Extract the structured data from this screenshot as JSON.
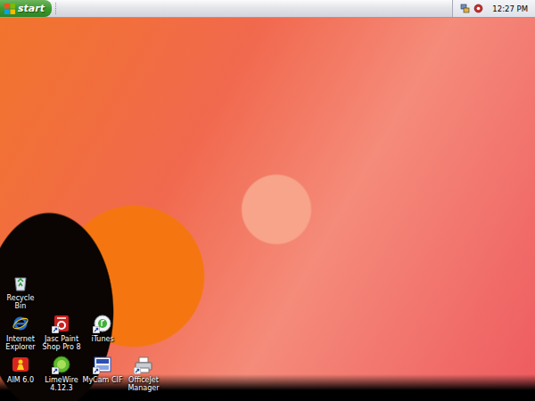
{
  "taskbar": {
    "start_button": {
      "label": "start"
    },
    "clock": "12:27 PM"
  },
  "desktop": {
    "icon_rows": [
      {
        "icons": [
          {
            "label": "Recycle Bin",
            "shortcut": false
          }
        ]
      },
      {
        "icons": [
          {
            "label": "Internet Explorer",
            "shortcut": false
          },
          {
            "label": "Jasc Paint Shop Pro 8",
            "shortcut": true
          },
          {
            "label": "iTunes",
            "shortcut": true
          }
        ]
      },
      {
        "icons": [
          {
            "label": "AIM 6.0",
            "shortcut": false
          },
          {
            "label": "LimeWire 4.12.3",
            "shortcut": true
          },
          {
            "label": "MyCam CIF",
            "shortcut": true
          },
          {
            "label": "OfficeJet Manager",
            "shortcut": true
          }
        ]
      }
    ]
  }
}
